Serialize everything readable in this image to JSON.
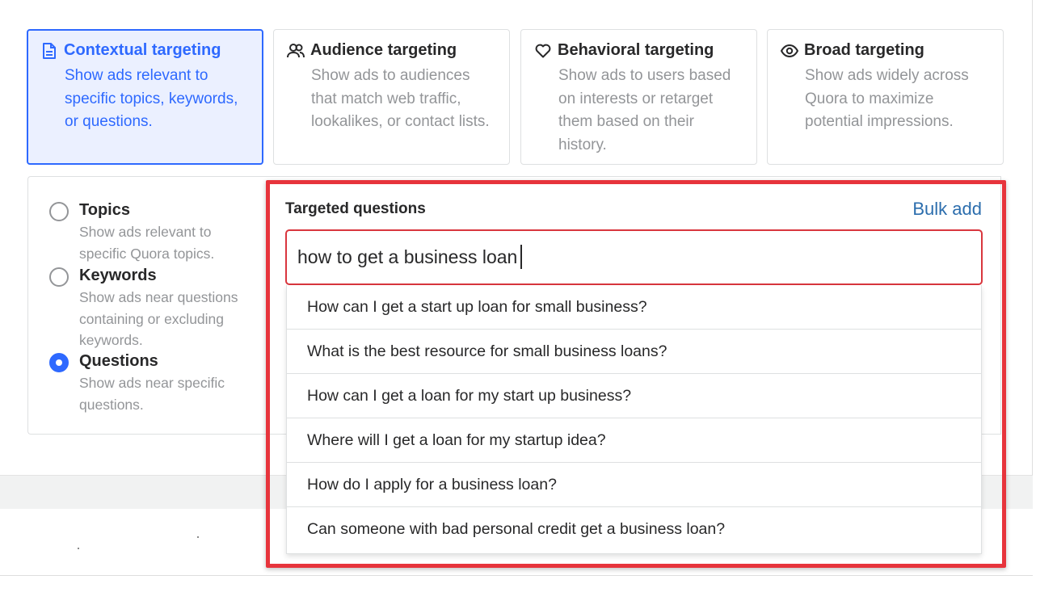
{
  "targeting_cards": [
    {
      "title": "Contextual targeting",
      "icon": "document-icon",
      "description": "Show ads relevant to specific topics, keywords, or questions.",
      "selected": true
    },
    {
      "title": "Audience targeting",
      "icon": "people-icon",
      "description": "Show ads to audiences that match web traffic, lookalikes, or contact lists.",
      "selected": false
    },
    {
      "title": "Behavioral targeting",
      "icon": "heart-icon",
      "description": "Show ads to users based on interests or retarget them based on their history.",
      "selected": false
    },
    {
      "title": "Broad targeting",
      "icon": "eye-icon",
      "description": "Show ads widely across Quora to maximize potential impressions.",
      "selected": false
    }
  ],
  "options": [
    {
      "title": "Topics",
      "description": "Show ads relevant to specific Quora topics.",
      "checked": false
    },
    {
      "title": "Keywords",
      "description": "Show ads near questions containing or excluding keywords.",
      "checked": false
    },
    {
      "title": "Questions",
      "description": "Show ads near specific questions.",
      "checked": true
    }
  ],
  "questions_panel": {
    "header": "Targeted questions",
    "bulk_add_label": "Bulk add",
    "search_value": "how to get a business loan",
    "suggestions": [
      "How can I get a start up loan for small business?",
      "What is the best resource for small business loans?",
      "How can I get a loan for my start up business?",
      "Where will I get a loan for my startup idea?",
      "How do I apply for a business loan?",
      "Can someone with bad personal credit get a business loan?"
    ]
  },
  "colors": {
    "accent_blue": "#2e69ff",
    "selected_bg": "#ebf0ff",
    "highlight_red": "#e7343c",
    "link_blue": "#2b6dad",
    "muted_text": "#939598"
  }
}
